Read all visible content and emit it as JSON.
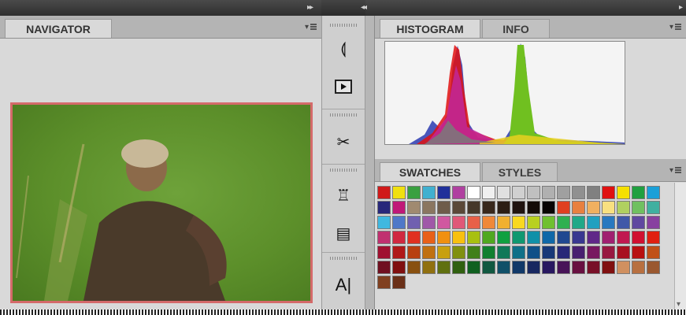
{
  "topbar": {
    "collapse_left": "▸▸",
    "collapse_right": "◂◂",
    "expand": "▸"
  },
  "navigator": {
    "tab_label": "NAVIGATOR"
  },
  "histogram_panel": {
    "tabs": [
      {
        "label": "HISTOGRAM",
        "active": true
      },
      {
        "label": "INFO",
        "active": false
      }
    ]
  },
  "swatches_panel": {
    "tabs": [
      {
        "label": "SWATCHES",
        "active": true
      },
      {
        "label": "STYLES",
        "active": false
      }
    ]
  },
  "toolstrip": {
    "tools": [
      "history-brush-icon",
      "play-action-icon",
      "brush-tools-icon",
      "clone-source-icon",
      "tool-presets-icon",
      "character-text-icon"
    ]
  },
  "colors": {
    "panel_bg": "#d9d9d9",
    "accent_border": "#d46a6a",
    "topbar": "#3a3a3a"
  },
  "swatches": [
    [
      "#d01a1a",
      "#f0e010",
      "#3aa040",
      "#40b0d0",
      "#20309a",
      "#b040a0",
      "#ffffff",
      "#f0f0f0",
      "#e0e0e0",
      "#d0d0d0",
      "#c0c0c0",
      "#b0b0b0",
      "#a0a0a0",
      "#909090",
      "#808080",
      "#e01010",
      "#f5e000",
      "#20a040",
      "#1aa0d8"
    ],
    [
      "#28287a",
      "#c01878",
      "#a08a70",
      "#8a7660",
      "#6e5c4a",
      "#5a4838",
      "#46382a",
      "#38281c",
      "#2c1e14",
      "#201410",
      "#140c08",
      "#080404",
      "#e04020",
      "#e88040",
      "#f0b060",
      "#f8e080",
      "#b0d060",
      "#70c060",
      "#40b0a0"
    ],
    [
      "#40b8e0",
      "#5078c8",
      "#7060b0",
      "#a058a8",
      "#d058a0",
      "#e05878",
      "#e86048",
      "#f08838",
      "#f0b030",
      "#f8d820",
      "#b8d020",
      "#70c030",
      "#30b050",
      "#20a888",
      "#20a0c0",
      "#2878c0",
      "#4058a8",
      "#6048a0",
      "#8840a0"
    ],
    [
      "#c03070",
      "#d02840",
      "#e03020",
      "#e86018",
      "#f09010",
      "#f8c010",
      "#a8c010",
      "#50a820",
      "#10a040",
      "#109870",
      "#1090a8",
      "#1068a8",
      "#204890",
      "#383890",
      "#602888",
      "#a02070",
      "#c01850",
      "#d01030",
      "#e02010"
    ],
    [
      "#a01030",
      "#b01818",
      "#b84010",
      "#c07010",
      "#c8a010",
      "#809010",
      "#408018",
      "#108030",
      "#107858",
      "#107088",
      "#105088",
      "#183878",
      "#282878",
      "#482070",
      "#781860",
      "#981840",
      "#a81020",
      "#b81010",
      "#c05018"
    ],
    [
      "#701020",
      "#801010",
      "#885010",
      "#907010",
      "#607010",
      "#306010",
      "#106020",
      "#105840",
      "#105068",
      "#103868",
      "#182860",
      "#281860",
      "#481458",
      "#681040",
      "#781028",
      "#801010",
      "#d09060",
      "#b87040",
      "#9a5830"
    ],
    [
      "#804020",
      "#6a3018"
    ]
  ]
}
